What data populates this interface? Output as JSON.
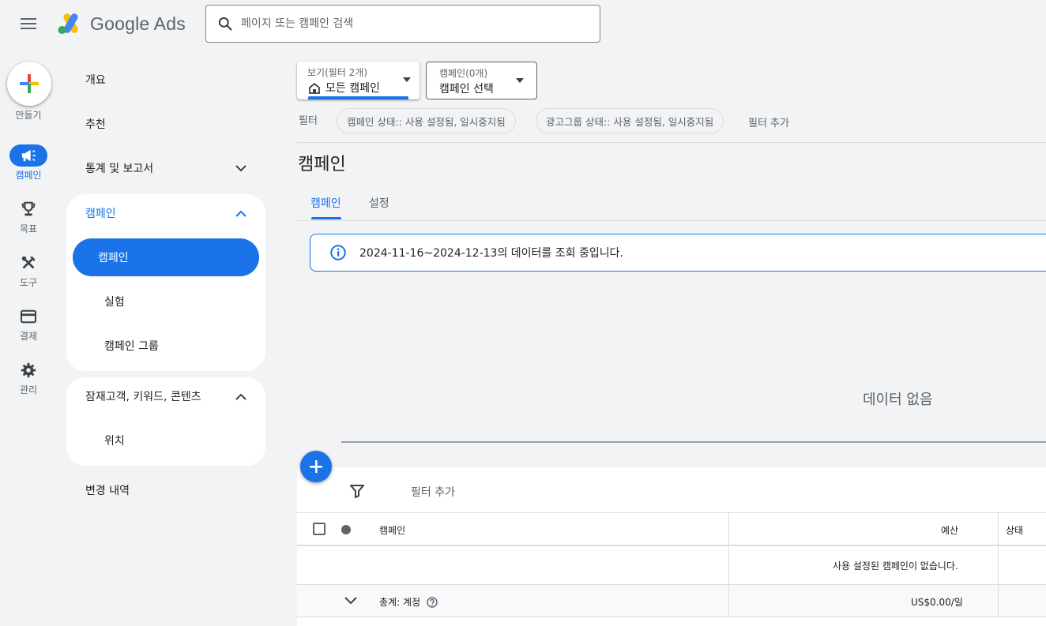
{
  "app": {
    "name": "Google Ads"
  },
  "search": {
    "placeholder": "페이지 또는 캠페인 검색"
  },
  "rail": {
    "create_label": "만들기",
    "items": [
      {
        "label": "캠페인",
        "icon": "megaphone-icon",
        "active": true
      },
      {
        "label": "목표",
        "icon": "trophy-icon"
      },
      {
        "label": "도구",
        "icon": "tools-icon"
      },
      {
        "label": "결제",
        "icon": "credit-card-icon"
      },
      {
        "label": "관리",
        "icon": "gear-icon"
      }
    ]
  },
  "sidenav": {
    "overview": "개요",
    "recommendations": "추천",
    "stats": "통계 및 보고서",
    "campaign_group": {
      "title": "캠페인",
      "items": [
        "캠페인",
        "실험",
        "캠페인 그룹"
      ]
    },
    "audience_group": {
      "title": "잠재고객, 키워드, 콘텐츠",
      "items": [
        "위치"
      ]
    },
    "history": "변경 내역"
  },
  "view_dropdown": {
    "small": "보기(필터 2개)",
    "value": "모든 캠페인"
  },
  "campaign_dropdown": {
    "small": "캠페인(0개)",
    "value": "캠페인 선택"
  },
  "filters": {
    "label": "필터",
    "chips": [
      "캠페인 상태:: 사용 설정됨, 일시중지됨",
      "광고그룹 상태:: 사용 설정됨, 일시중지됨"
    ],
    "add": "필터 추가"
  },
  "page_title": "캠페인",
  "tabs": [
    {
      "label": "캠페인",
      "active": true
    },
    {
      "label": "설정"
    }
  ],
  "info_banner": "2024-11-16~2024-12-13의 데이터를 조회 중입니다.",
  "no_data": "데이터 없음",
  "table": {
    "add_filter": "필터 추가",
    "columns": {
      "campaign": "캠페인",
      "budget": "예산",
      "status": "상태"
    },
    "empty_message": "사용 설정된 캠페인이 없습니다.",
    "total_label": "총계: 계정",
    "total_budget": "US$0.00/일"
  },
  "colors": {
    "accent": "#1a73e8",
    "background": "#f1f3f4"
  }
}
